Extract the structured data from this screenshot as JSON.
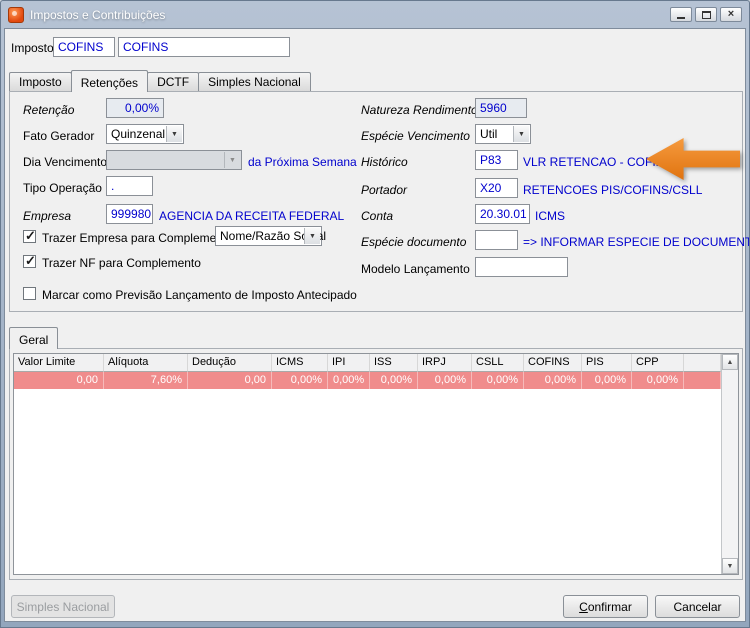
{
  "window": {
    "title": "Impostos e Contribuições"
  },
  "header": {
    "label": "Imposto",
    "code": "COFINS",
    "name": "COFINS"
  },
  "tabs": [
    {
      "label": "Imposto",
      "active": false
    },
    {
      "label": "Retenções",
      "active": true
    },
    {
      "label": "DCTF",
      "active": false
    },
    {
      "label": "Simples Nacional",
      "active": false
    }
  ],
  "form": {
    "retencao": {
      "label": "Retenção",
      "value": "0,00%"
    },
    "fato_gerador": {
      "label": "Fato Gerador",
      "value": "Quinzenal"
    },
    "dia_vencimento": {
      "label": "Dia Vencimento",
      "value": "",
      "hint": "da Próxima Semana"
    },
    "tipo_operacao": {
      "label": "Tipo Operação",
      "value": "."
    },
    "empresa": {
      "label": "Empresa",
      "value": "999980",
      "description": "AGENCIA DA RECEITA FEDERAL"
    },
    "checkboxes": [
      {
        "label": "Trazer Empresa para Complemento",
        "checked": true,
        "dropdown_value": "Nome/Razão Social"
      },
      {
        "label": "Trazer NF para Complemento",
        "checked": true
      },
      {
        "label": "Marcar como Previsão Lançamento de Imposto Antecipado",
        "checked": false
      }
    ],
    "natureza_rendimento": {
      "label": "Natureza Rendimento",
      "value": "5960"
    },
    "especie_vencimento": {
      "label": "Espécie Vencimento",
      "value": "Util"
    },
    "historico": {
      "label": "Histórico",
      "value": "P83",
      "description": "VLR RETENCAO - COFINS"
    },
    "portador": {
      "label": "Portador",
      "value": "X20",
      "description": "RETENCOES PIS/COFINS/CSLL"
    },
    "conta": {
      "label": "Conta",
      "value": "20.30.01",
      "description": "ICMS"
    },
    "especie_documento": {
      "label": "Espécie documento",
      "value": "",
      "description": "=> INFORMAR ESPECIE DE DOCUMENTO"
    },
    "modelo_lancamento": {
      "label": "Modelo Lançamento",
      "value": ""
    }
  },
  "geral_tab": {
    "label": "Geral"
  },
  "table": {
    "columns": [
      "Valor Limite",
      "Alíquota",
      "Dedução",
      "ICMS",
      "IPI",
      "ISS",
      "IRPJ",
      "CSLL",
      "COFINS",
      "PIS",
      "CPP"
    ],
    "rows": [
      [
        "0,00",
        "7,60%",
        "0,00",
        "0,00%",
        "0,00%",
        "0,00%",
        "0,00%",
        "0,00%",
        "0,00%",
        "0,00%",
        "0,00%"
      ]
    ]
  },
  "footer": {
    "simples_nacional": "Simples Nacional",
    "confirmar": "Confirmar",
    "cancelar": "Cancelar"
  },
  "colors": {
    "value_blue": "#0000CD",
    "highlight_row": "#F08C8C",
    "arrow_orange": "#E87A1E",
    "titlebar": "#9FB1C6"
  }
}
